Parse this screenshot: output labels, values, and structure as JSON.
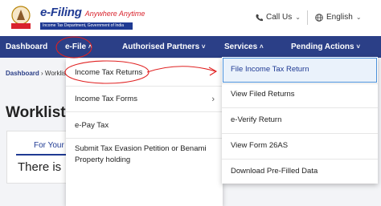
{
  "header": {
    "brand": "e-Filing",
    "tagline": "Anywhere Anytime",
    "subtitle": "Income Tax Department, Government of India",
    "call_us": "Call Us",
    "language": "English"
  },
  "nav": {
    "items": [
      {
        "label": "Dashboard"
      },
      {
        "label": "e-File"
      },
      {
        "label": "Authorised Partners"
      },
      {
        "label": "Services"
      },
      {
        "label": "Pending Actions"
      }
    ]
  },
  "breadcrumb": {
    "home": "Dashboard",
    "current": "Worklist"
  },
  "page": {
    "title": "Worklist",
    "tab": "For Your A",
    "message": "There is"
  },
  "efile_menu": {
    "items": [
      {
        "label": "Income Tax Returns"
      },
      {
        "label": "Income Tax Forms"
      },
      {
        "label": "e-Pay Tax"
      },
      {
        "label": "Submit Tax Evasion Petition or Benami Property holding"
      }
    ]
  },
  "itr_submenu": {
    "items": [
      {
        "label": "File Income Tax Return"
      },
      {
        "label": "View Filed Returns"
      },
      {
        "label": "e-Verify Return"
      },
      {
        "label": "View Form 26AS"
      },
      {
        "label": "Download Pre-Filled Data"
      }
    ]
  },
  "colors": {
    "nav_bg": "#2b3f87",
    "brand_blue": "#1f3a93",
    "annotation_red": "#e02020",
    "highlight_border": "#4a90d9"
  }
}
